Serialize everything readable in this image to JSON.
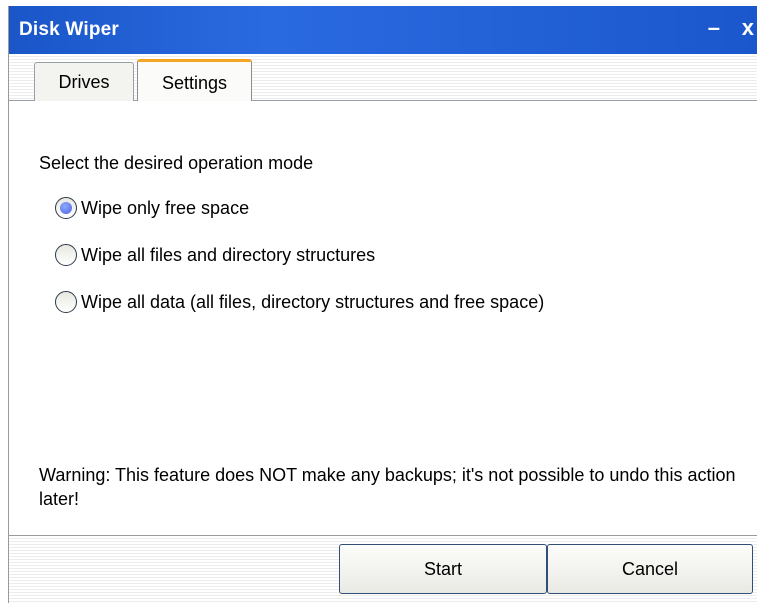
{
  "window": {
    "title": "Disk Wiper",
    "minimize_glyph": "–",
    "close_glyph": "x"
  },
  "tabs": [
    {
      "label": "Drives",
      "selected": false
    },
    {
      "label": "Settings",
      "selected": true
    }
  ],
  "settings": {
    "prompt": "Select the desired operation mode",
    "modes": [
      {
        "label": "Wipe only free space",
        "checked": true
      },
      {
        "label": "Wipe all files and directory structures",
        "checked": false
      },
      {
        "label": "Wipe all data (all files, directory structures and free space)",
        "checked": false
      }
    ],
    "warning": "Warning: This feature does NOT make any backups; it's not possible to undo this action later!"
  },
  "buttons": {
    "start": "Start",
    "cancel": "Cancel"
  },
  "colors": {
    "titlebar": "#1a56c8",
    "selected_tab_accent": "#f5a623",
    "radio_dot": "#4a63e8"
  }
}
